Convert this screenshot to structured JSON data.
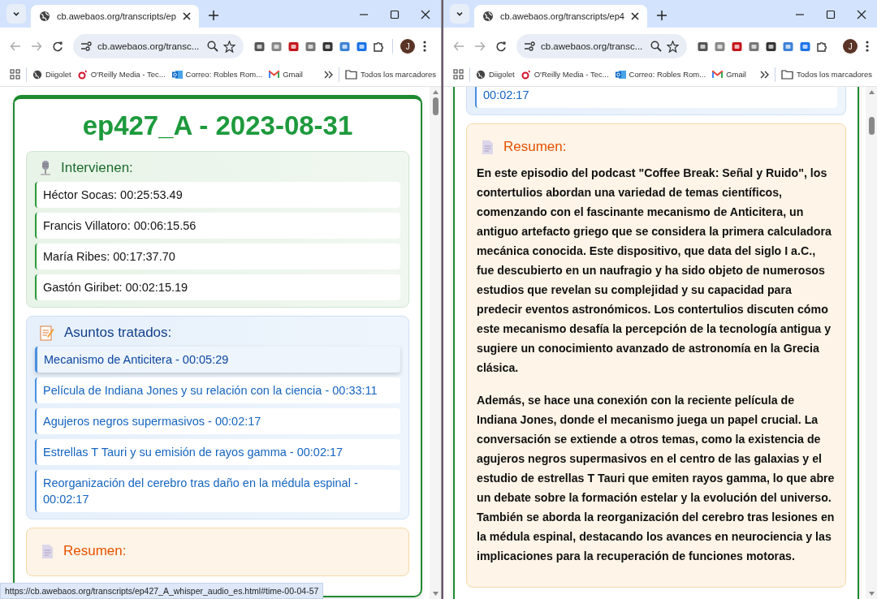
{
  "windows": [
    {
      "tab": {
        "title": "cb.awebaos.org/transcripts/ep"
      },
      "nav": {
        "back_disabled": true,
        "forward_disabled": true
      },
      "address": "cb.awebaos.org/transc...",
      "avatar": "J",
      "bookmarks": [
        "Diigolet",
        "O'Reilly Media - Tec...",
        "Correo: Robles Rom...",
        "Gmail"
      ],
      "all_bookmarks": "Todos los marcadores",
      "page": {
        "title": "ep427_A - 2023-08-31",
        "speakers": {
          "heading": "Intervienen:",
          "items": [
            "Héctor Socas: 00:25:53.49",
            "Francis Villatoro: 00:06:15.56",
            "María Ribes: 00:17:37.70",
            "Gastón Giribet: 00:02:15.19"
          ]
        },
        "topics": {
          "heading": "Asuntos tratados:",
          "items": [
            {
              "label": "Mecanismo de Anticitera - 00:05:29",
              "hovered": true
            },
            {
              "label": "Película de Indiana Jones y su relación con la ciencia - 00:33:11",
              "hovered": false
            },
            {
              "label": "Agujeros negros supermasivos - 00:02:17",
              "hovered": false
            },
            {
              "label": "Estrellas T Tauri y su emisión de rayos gamma - 00:02:17",
              "hovered": false
            },
            {
              "label": "Reorganización del cerebro tras daño en la médula espinal - 00:02:17",
              "hovered": false
            }
          ]
        },
        "summary": {
          "heading": "Resumen:"
        }
      },
      "status_url": "https://cb.awebaos.org/transcripts/ep427_A_whisper_audio_es.html#time-00-04-57"
    },
    {
      "tab": {
        "title": "cb.awebaos.org/transcripts/ep4"
      },
      "nav": {
        "back_disabled": true,
        "forward_disabled": true
      },
      "address": "cb.awebaos.org/transc...",
      "avatar": "J",
      "bookmarks": [
        "Diigolet",
        "O'Reilly Media - Tec...",
        "Correo: Robles Rom...",
        "Gmail"
      ],
      "all_bookmarks": "Todos los marcadores",
      "page": {
        "topics": {
          "items": [
            {
              "label": "00:02:17",
              "hovered": false
            }
          ]
        },
        "summary": {
          "heading": "Resumen:",
          "paragraphs": [
            "En este episodio del podcast \"Coffee Break: Señal y Ruido\", los contertulios abordan una variedad de temas científicos, comenzando con el fascinante mecanismo de Anticitera, un antiguo artefacto griego que se considera la primera calculadora mecánica conocida. Este dispositivo, que data del siglo I a.C., fue descubierto en un naufragio y ha sido objeto de numerosos estudios que revelan su complejidad y su capacidad para predecir eventos astronómicos. Los contertulios discuten cómo este mecanismo desafía la percepción de la tecnología antigua y sugiere un conocimiento avanzado de astronomía en la Grecia clásica.",
            "Además, se hace una conexión con la reciente película de Indiana Jones, donde el mecanismo juega un papel crucial. La conversación se extiende a otros temas, como la existencia de agujeros negros supermasivos en el centro de las galaxias y el estudio de estrellas T Tauri que emiten rayos gamma, lo que abre un debate sobre la formación estelar y la evolución del universo. También se aborda la reorganización del cerebro tras lesiones en la médula espinal, destacando los avances en neurociencia y las implicaciones para la recuperación de funciones motoras."
          ]
        }
      }
    }
  ]
}
